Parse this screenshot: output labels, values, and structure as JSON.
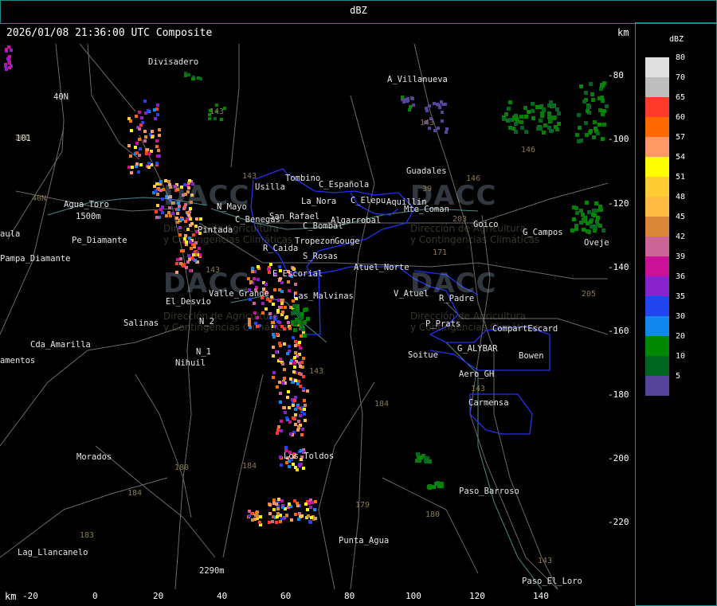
{
  "header": {
    "title": "dBZ"
  },
  "caption": "2026/01/08 21:36:00 UTC Composite",
  "units": {
    "top": "km",
    "bottom": "km"
  },
  "x_ticks": [
    "-20",
    "0",
    "20",
    "40",
    "60",
    "80",
    "100",
    "120",
    "140"
  ],
  "y_ticks": [
    "-80",
    "-100",
    "-120",
    "-140",
    "-160",
    "-180",
    "-200",
    "-220"
  ],
  "legend": {
    "title": "dBZ",
    "levels": [
      {
        "label": "80",
        "color": "#e0e0e0"
      },
      {
        "label": "70",
        "color": "#bdbdbd"
      },
      {
        "label": "65",
        "color": "#ff3a2a"
      },
      {
        "label": "60",
        "color": "#ff6a00"
      },
      {
        "label": "57",
        "color": "#ff9966"
      },
      {
        "label": "54",
        "color": "#ffff00"
      },
      {
        "label": "51",
        "color": "#ffcc33"
      },
      {
        "label": "48",
        "color": "#ffbb44"
      },
      {
        "label": "45",
        "color": "#d9883a"
      },
      {
        "label": "42",
        "color": "#cc6699"
      },
      {
        "label": "39",
        "color": "#cc1199"
      },
      {
        "label": "36",
        "color": "#8822cc"
      },
      {
        "label": "35",
        "color": "#2244ee"
      },
      {
        "label": "30",
        "color": "#1188ee"
      },
      {
        "label": "20",
        "color": "#008800"
      },
      {
        "label": "10",
        "color": "#006622"
      },
      {
        "label": "5",
        "color": "#55449a"
      }
    ]
  },
  "places": [
    "Divisadero",
    "A_Villanueva",
    "40N",
    "101",
    "Usilla",
    "Tombino",
    "C_Española",
    "La_Nora",
    "C_Elepu",
    "Aquillin",
    "Mte_Coman",
    "Guadales",
    "Goico",
    "G_Campos",
    "Oveje",
    "Agua_Toro",
    "1500m",
    "aula",
    "Pampa_Diamante",
    "San_Rafael",
    "C_Benegas",
    "C_Bombal",
    "Algarrobal",
    "Tropezon",
    "Gouge",
    "R_Caida",
    "S_Rosas",
    "Atuel_Norte",
    "E_Escorial",
    "Valle_Grande",
    "Las_Malvinas",
    "V_Atuel",
    "R_Padre",
    "El_Desvio",
    "Salinas",
    "N_2",
    "N_1",
    "Nihuil",
    "Cda_Amarilla",
    "amentos",
    "P_Prats",
    "CompartEscard",
    "G_ALYBAR",
    "Soitue",
    "Bowen",
    "Aero_GH",
    "Carmensa",
    "Morados",
    "Los_Toldos",
    "Paso_Barroso",
    "Punta_Agua",
    "Lag_Llancanelo",
    "Paso_El_Loro",
    "2290m",
    "N_Mayo",
    "Pintada",
    "Pe_Diamante"
  ],
  "routes": [
    "143",
    "40N",
    "143",
    "143",
    "146",
    "146",
    "203",
    "171",
    "143",
    "143",
    "180",
    "184",
    "184",
    "179",
    "180",
    "183",
    "184",
    "143",
    "205",
    "39",
    "101",
    "143"
  ],
  "watermark": {
    "logo_text": "DACC",
    "sub_line1": "Dirección de Agricultura",
    "sub_line2": "y Contingencias Climáticas"
  }
}
